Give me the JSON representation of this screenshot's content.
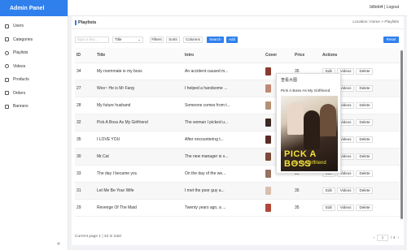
{
  "app": {
    "title": "Admin Panel",
    "user": "bi8ebt4 | Logout"
  },
  "sidebar": {
    "items": [
      {
        "label": "Users",
        "icon": "user-icon"
      },
      {
        "label": "Categories",
        "icon": "categories-icon"
      },
      {
        "label": "Playlists",
        "icon": "playlist-icon"
      },
      {
        "label": "Videos",
        "icon": "video-icon"
      },
      {
        "label": "Products",
        "icon": "product-icon"
      },
      {
        "label": "Orders",
        "icon": "order-icon"
      },
      {
        "label": "Banners",
        "icon": "banner-icon"
      }
    ],
    "collapse": "«"
  },
  "page": {
    "title": "Playlists",
    "location": "Location: Home > Playlists"
  },
  "toolbar": {
    "search_placeholder": "input a key...",
    "select_value": "Title",
    "filters": "Filters",
    "sorts": "Sorts",
    "columns": "Columns",
    "search": "Search",
    "add": "Add",
    "reset": "Reset"
  },
  "table": {
    "headers": {
      "id": "ID",
      "title": "Title",
      "intro": "Intro",
      "cover": "Cover",
      "price": "Price",
      "actions": "Actions"
    },
    "actions": {
      "edit": "Edit",
      "videos": "Videos",
      "delete": "Delete"
    },
    "rows": [
      {
        "id": "34",
        "title": "My roommate is my boss",
        "intro": "An accident caused m...",
        "price": "35"
      },
      {
        "id": "27",
        "title": "Woo~ He is Mr Fang",
        "intro": "I helped a handsome ...",
        "price": "35"
      },
      {
        "id": "28",
        "title": "My future husband",
        "intro": "Someone comes from t...",
        "price": "35"
      },
      {
        "id": "32",
        "title": "Pick A Boss As My Girlfriend",
        "intro": "The woman I picked u...",
        "price": "35"
      },
      {
        "id": "35",
        "title": "I LOVE YOU",
        "intro": "After encountering t...",
        "price": "35"
      },
      {
        "id": "30",
        "title": "Mr.Cat",
        "intro": "The new manager is s...",
        "price": "35"
      },
      {
        "id": "33",
        "title": "The day I became you",
        "intro": "On the day of the we...",
        "price": "35"
      },
      {
        "id": "31",
        "title": "Let Me Be Your Wife",
        "intro": "I met the poor guy a...",
        "price": "35"
      },
      {
        "id": "29",
        "title": "Revenge Of The Maid",
        "intro": "Twenty years ago, a ...",
        "price": "35"
      }
    ]
  },
  "popover": {
    "header": "查看大图",
    "title": "Pick A Boss As My Girlfriend",
    "poster_line1": "PICK A BOSS",
    "poster_line2": "as my girlfriend"
  },
  "footer": {
    "summary": "Current page 1 | 34 in total",
    "page": "1",
    "total_pages": "/ 4",
    "prev": "‹",
    "next": "›"
  }
}
